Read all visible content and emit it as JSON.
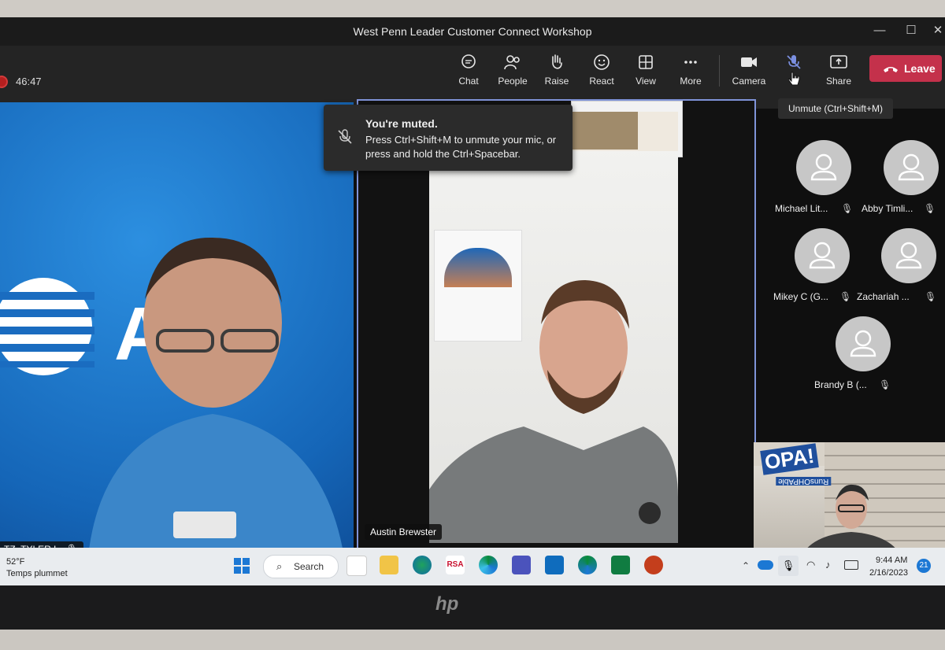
{
  "window": {
    "title": "West Penn Leader Customer Connect Workshop",
    "min": "—",
    "max": "☐",
    "close": "✕"
  },
  "meeting": {
    "timer": "46:47"
  },
  "toolbar": {
    "chat": "Chat",
    "people": "People",
    "raise": "Raise",
    "react": "React",
    "view": "View",
    "more": "More",
    "camera": "Camera",
    "mic": "Mic",
    "share": "Share",
    "leave": "Leave"
  },
  "toast": {
    "title": "You're muted.",
    "body": "Press Ctrl+Shift+M to unmute your mic, or press and hold the Ctrl+Spacebar."
  },
  "tooltip": "Unmute (Ctrl+Shift+M)",
  "tiles": {
    "left_name": "TZ, TYLER L",
    "center_name": "Austin Brewster",
    "brand": "AT"
  },
  "participants": [
    {
      "name": "Michael Lit..."
    },
    {
      "name": "Abby Timli..."
    },
    {
      "name": "Mikey C (G..."
    },
    {
      "name": "Zachariah ..."
    },
    {
      "name": "Brandy B (..."
    }
  ],
  "selfview": {
    "logo": "OPA!",
    "tag": "RunsOHPAble"
  },
  "taskbar": {
    "weather_temp": "52°F",
    "weather_desc": "Temps plummet",
    "search": "Search",
    "time": "9:44 AM",
    "date": "2/16/2023",
    "notif_count": "21",
    "app_rsa": "RSA"
  },
  "laptop": {
    "brand": "hp"
  }
}
